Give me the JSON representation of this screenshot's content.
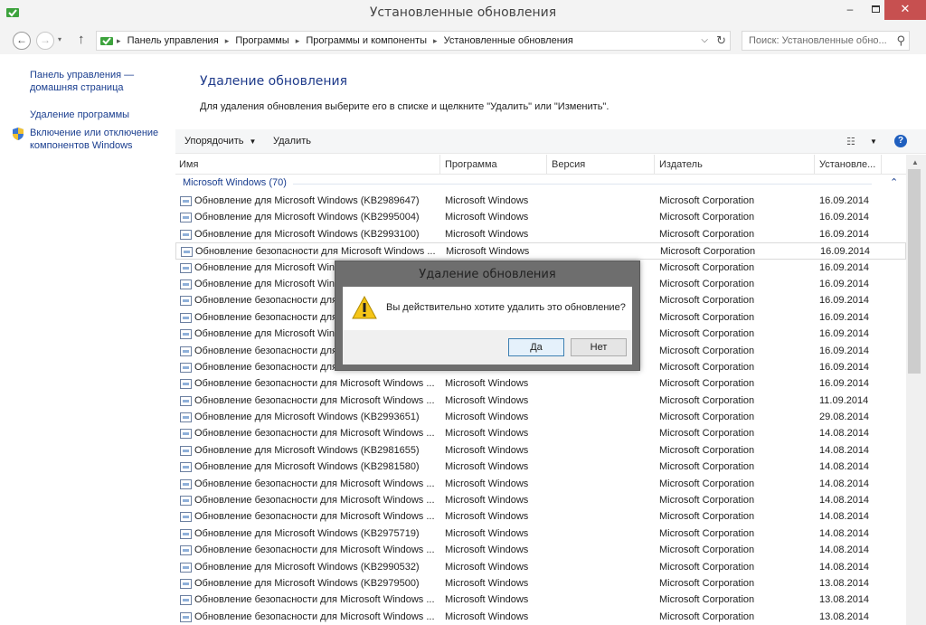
{
  "window": {
    "title": "Установленные обновления",
    "minimize": "–",
    "close": "✕"
  },
  "address": {
    "breadcrumbs": [
      "Панель управления",
      "Программы",
      "Программы и компоненты",
      "Установленные обновления"
    ],
    "search_placeholder": "Поиск: Установленные обно..."
  },
  "leftpane": {
    "home_link": "Панель управления — домашняя страница",
    "uninstall_link": "Удаление программы",
    "features_link": "Включение или отключение компонентов Windows"
  },
  "main": {
    "title": "Удаление обновления",
    "description": "Для удаления обновления выберите его в списке и щелкните \"Удалить\" или \"Изменить\"."
  },
  "toolbar": {
    "organize": "Упорядочить",
    "delete": "Удалить",
    "help": "?"
  },
  "list": {
    "columns": [
      "Имя",
      "Программа",
      "Версия",
      "Издатель",
      "Установле..."
    ],
    "group": "Microsoft Windows (70)",
    "rows": [
      {
        "name": "Обновление для Microsoft Windows (KB2989647)",
        "program": "Microsoft Windows",
        "publisher": "Microsoft Corporation",
        "date": "16.09.2014"
      },
      {
        "name": "Обновление для Microsoft Windows (KB2995004)",
        "program": "Microsoft Windows",
        "publisher": "Microsoft Corporation",
        "date": "16.09.2014"
      },
      {
        "name": "Обновление для Microsoft Windows (KB2993100)",
        "program": "Microsoft Windows",
        "publisher": "Microsoft Corporation",
        "date": "16.09.2014"
      },
      {
        "name": "Обновление безопасности для Microsoft Windows ...",
        "program": "Microsoft Windows",
        "publisher": "Microsoft Corporation",
        "date": "16.09.2014"
      },
      {
        "name": "Обновление для Microsoft Win",
        "program": "",
        "publisher": "Microsoft Corporation",
        "date": "16.09.2014"
      },
      {
        "name": "Обновление для Microsoft Win",
        "program": "",
        "publisher": "Microsoft Corporation",
        "date": "16.09.2014"
      },
      {
        "name": "Обновление безопасности для",
        "program": "",
        "publisher": "Microsoft Corporation",
        "date": "16.09.2014"
      },
      {
        "name": "Обновление безопасности для",
        "program": "",
        "publisher": "Microsoft Corporation",
        "date": "16.09.2014"
      },
      {
        "name": "Обновление для Microsoft Win",
        "program": "",
        "publisher": "Microsoft Corporation",
        "date": "16.09.2014"
      },
      {
        "name": "Обновление безопасности для",
        "program": "",
        "publisher": "Microsoft Corporation",
        "date": "16.09.2014"
      },
      {
        "name": "Обновление безопасности для",
        "program": "",
        "publisher": "Microsoft Corporation",
        "date": "16.09.2014"
      },
      {
        "name": "Обновление безопасности для Microsoft Windows ...",
        "program": "Microsoft Windows",
        "publisher": "Microsoft Corporation",
        "date": "16.09.2014"
      },
      {
        "name": "Обновление безопасности для Microsoft Windows ...",
        "program": "Microsoft Windows",
        "publisher": "Microsoft Corporation",
        "date": "11.09.2014"
      },
      {
        "name": "Обновление для Microsoft Windows (KB2993651)",
        "program": "Microsoft Windows",
        "publisher": "Microsoft Corporation",
        "date": "29.08.2014"
      },
      {
        "name": "Обновление безопасности для Microsoft Windows ...",
        "program": "Microsoft Windows",
        "publisher": "Microsoft Corporation",
        "date": "14.08.2014"
      },
      {
        "name": "Обновление для Microsoft Windows (KB2981655)",
        "program": "Microsoft Windows",
        "publisher": "Microsoft Corporation",
        "date": "14.08.2014"
      },
      {
        "name": "Обновление для Microsoft Windows (KB2981580)",
        "program": "Microsoft Windows",
        "publisher": "Microsoft Corporation",
        "date": "14.08.2014"
      },
      {
        "name": "Обновление безопасности для Microsoft Windows ...",
        "program": "Microsoft Windows",
        "publisher": "Microsoft Corporation",
        "date": "14.08.2014"
      },
      {
        "name": "Обновление безопасности для Microsoft Windows ...",
        "program": "Microsoft Windows",
        "publisher": "Microsoft Corporation",
        "date": "14.08.2014"
      },
      {
        "name": "Обновление безопасности для Microsoft Windows ...",
        "program": "Microsoft Windows",
        "publisher": "Microsoft Corporation",
        "date": "14.08.2014"
      },
      {
        "name": "Обновление для Microsoft Windows (KB2975719)",
        "program": "Microsoft Windows",
        "publisher": "Microsoft Corporation",
        "date": "14.08.2014"
      },
      {
        "name": "Обновление безопасности для Microsoft Windows ...",
        "program": "Microsoft Windows",
        "publisher": "Microsoft Corporation",
        "date": "14.08.2014"
      },
      {
        "name": "Обновление для Microsoft Windows (KB2990532)",
        "program": "Microsoft Windows",
        "publisher": "Microsoft Corporation",
        "date": "14.08.2014"
      },
      {
        "name": "Обновление для Microsoft Windows (KB2979500)",
        "program": "Microsoft Windows",
        "publisher": "Microsoft Corporation",
        "date": "13.08.2014"
      },
      {
        "name": "Обновление безопасности для Microsoft Windows ...",
        "program": "Microsoft Windows",
        "publisher": "Microsoft Corporation",
        "date": "13.08.2014"
      },
      {
        "name": "Обновление безопасности для Microsoft Windows ...",
        "program": "Microsoft Windows",
        "publisher": "Microsoft Corporation",
        "date": "13.08.2014"
      }
    ]
  },
  "dialog": {
    "title": "Удаление обновления",
    "message": "Вы действительно хотите удалить это обновление?",
    "yes": "Да",
    "no": "Нет"
  },
  "colors": {
    "link": "#1a3e8f",
    "close_button": "#c75050",
    "help_badge": "#1f5fbf"
  }
}
